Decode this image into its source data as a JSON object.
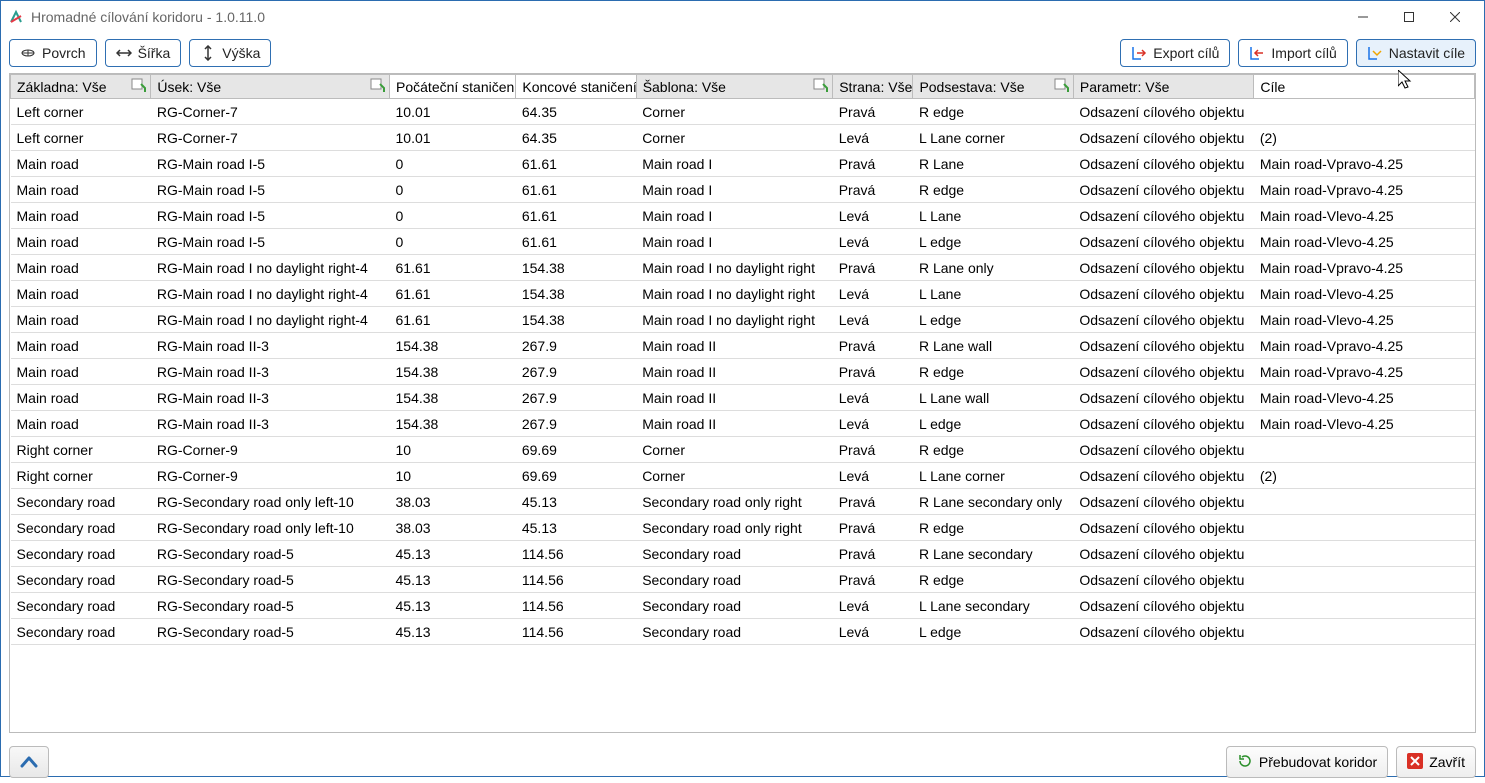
{
  "window": {
    "title": "Hromadné cílování koridoru - 1.0.11.0"
  },
  "toolbar": {
    "povrch": "Povrch",
    "sirka": "Šířka",
    "vyska": "Výška",
    "export_cilu": "Export cílů",
    "import_cilu": "Import cílů",
    "nastavit_cile": "Nastavit cíle"
  },
  "headers": {
    "zakladna": "Základna: Vše",
    "usek": "Úsek: Vše",
    "poc": "Počáteční staničení",
    "kon": "Koncové staničení",
    "sablona": "Šablona: Vše",
    "strana": "Strana: Vše",
    "podsestava": "Podsestava: Vše",
    "parametr": "Parametr: Vše",
    "cile": "Cíle"
  },
  "footer": {
    "prebudovat": "Přebudovat koridor",
    "zavrit": "Zavřít"
  },
  "rows": [
    {
      "zakladna": "Left corner",
      "usek": "RG-Corner-7",
      "poc": "10.01",
      "kon": "64.35",
      "sablona": "Corner",
      "strana": "Pravá",
      "podsestava": "R edge",
      "parametr": "Odsazení cílového objektu",
      "cile": ""
    },
    {
      "zakladna": "Left corner",
      "usek": "RG-Corner-7",
      "poc": "10.01",
      "kon": "64.35",
      "sablona": "Corner",
      "strana": "Levá",
      "podsestava": "L Lane corner",
      "parametr": "Odsazení cílového objektu",
      "cile": "(2)"
    },
    {
      "zakladna": "Main road",
      "usek": "RG-Main road I-5",
      "poc": "0",
      "kon": "61.61",
      "sablona": "Main road I",
      "strana": "Pravá",
      "podsestava": "R Lane",
      "parametr": "Odsazení cílového objektu",
      "cile": "Main road-Vpravo-4.25"
    },
    {
      "zakladna": "Main road",
      "usek": "RG-Main road I-5",
      "poc": "0",
      "kon": "61.61",
      "sablona": "Main road I",
      "strana": "Pravá",
      "podsestava": "R edge",
      "parametr": "Odsazení cílového objektu",
      "cile": "Main road-Vpravo-4.25"
    },
    {
      "zakladna": "Main road",
      "usek": "RG-Main road I-5",
      "poc": "0",
      "kon": "61.61",
      "sablona": "Main road I",
      "strana": "Levá",
      "podsestava": "L Lane",
      "parametr": "Odsazení cílového objektu",
      "cile": "Main road-Vlevo-4.25"
    },
    {
      "zakladna": "Main road",
      "usek": "RG-Main road I-5",
      "poc": "0",
      "kon": "61.61",
      "sablona": "Main road I",
      "strana": "Levá",
      "podsestava": "L edge",
      "parametr": "Odsazení cílového objektu",
      "cile": "Main road-Vlevo-4.25"
    },
    {
      "zakladna": "Main road",
      "usek": "RG-Main road I no daylight right-4",
      "poc": "61.61",
      "kon": "154.38",
      "sablona": "Main road I no daylight right",
      "strana": "Pravá",
      "podsestava": "R Lane only",
      "parametr": "Odsazení cílového objektu",
      "cile": "Main road-Vpravo-4.25"
    },
    {
      "zakladna": "Main road",
      "usek": "RG-Main road I no daylight right-4",
      "poc": "61.61",
      "kon": "154.38",
      "sablona": "Main road I no daylight right",
      "strana": "Levá",
      "podsestava": "L Lane",
      "parametr": "Odsazení cílového objektu",
      "cile": "Main road-Vlevo-4.25"
    },
    {
      "zakladna": "Main road",
      "usek": "RG-Main road I no daylight right-4",
      "poc": "61.61",
      "kon": "154.38",
      "sablona": "Main road I no daylight right",
      "strana": "Levá",
      "podsestava": "L edge",
      "parametr": "Odsazení cílového objektu",
      "cile": "Main road-Vlevo-4.25"
    },
    {
      "zakladna": "Main road",
      "usek": "RG-Main road II-3",
      "poc": "154.38",
      "kon": "267.9",
      "sablona": "Main road II",
      "strana": "Pravá",
      "podsestava": "R Lane wall",
      "parametr": "Odsazení cílového objektu",
      "cile": "Main road-Vpravo-4.25"
    },
    {
      "zakladna": "Main road",
      "usek": "RG-Main road II-3",
      "poc": "154.38",
      "kon": "267.9",
      "sablona": "Main road II",
      "strana": "Pravá",
      "podsestava": "R edge",
      "parametr": "Odsazení cílového objektu",
      "cile": "Main road-Vpravo-4.25"
    },
    {
      "zakladna": "Main road",
      "usek": "RG-Main road II-3",
      "poc": "154.38",
      "kon": "267.9",
      "sablona": "Main road II",
      "strana": "Levá",
      "podsestava": "L Lane wall",
      "parametr": "Odsazení cílového objektu",
      "cile": "Main road-Vlevo-4.25"
    },
    {
      "zakladna": "Main road",
      "usek": "RG-Main road II-3",
      "poc": "154.38",
      "kon": "267.9",
      "sablona": "Main road II",
      "strana": "Levá",
      "podsestava": "L edge",
      "parametr": "Odsazení cílového objektu",
      "cile": "Main road-Vlevo-4.25"
    },
    {
      "zakladna": "Right corner",
      "usek": "RG-Corner-9",
      "poc": "10",
      "kon": "69.69",
      "sablona": "Corner",
      "strana": "Pravá",
      "podsestava": "R edge",
      "parametr": "Odsazení cílového objektu",
      "cile": ""
    },
    {
      "zakladna": "Right corner",
      "usek": "RG-Corner-9",
      "poc": "10",
      "kon": "69.69",
      "sablona": "Corner",
      "strana": "Levá",
      "podsestava": "L Lane corner",
      "parametr": "Odsazení cílového objektu",
      "cile": "(2)"
    },
    {
      "zakladna": "Secondary road",
      "usek": "RG-Secondary road only left-10",
      "poc": "38.03",
      "kon": "45.13",
      "sablona": "Secondary road only right",
      "strana": "Pravá",
      "podsestava": "R Lane secondary only",
      "parametr": "Odsazení cílového objektu",
      "cile": ""
    },
    {
      "zakladna": "Secondary road",
      "usek": "RG-Secondary road only left-10",
      "poc": "38.03",
      "kon": "45.13",
      "sablona": "Secondary road only right",
      "strana": "Pravá",
      "podsestava": "R edge",
      "parametr": "Odsazení cílového objektu",
      "cile": ""
    },
    {
      "zakladna": "Secondary road",
      "usek": "RG-Secondary road-5",
      "poc": "45.13",
      "kon": "114.56",
      "sablona": "Secondary road",
      "strana": "Pravá",
      "podsestava": "R Lane secondary",
      "parametr": "Odsazení cílového objektu",
      "cile": ""
    },
    {
      "zakladna": "Secondary road",
      "usek": "RG-Secondary road-5",
      "poc": "45.13",
      "kon": "114.56",
      "sablona": "Secondary road",
      "strana": "Pravá",
      "podsestava": "R edge",
      "parametr": "Odsazení cílového objektu",
      "cile": ""
    },
    {
      "zakladna": "Secondary road",
      "usek": "RG-Secondary road-5",
      "poc": "45.13",
      "kon": "114.56",
      "sablona": "Secondary road",
      "strana": "Levá",
      "podsestava": "L Lane secondary",
      "parametr": "Odsazení cílového objektu",
      "cile": ""
    },
    {
      "zakladna": "Secondary road",
      "usek": "RG-Secondary road-5",
      "poc": "45.13",
      "kon": "114.56",
      "sablona": "Secondary road",
      "strana": "Levá",
      "podsestava": "L edge",
      "parametr": "Odsazení cílového objektu",
      "cile": ""
    }
  ]
}
